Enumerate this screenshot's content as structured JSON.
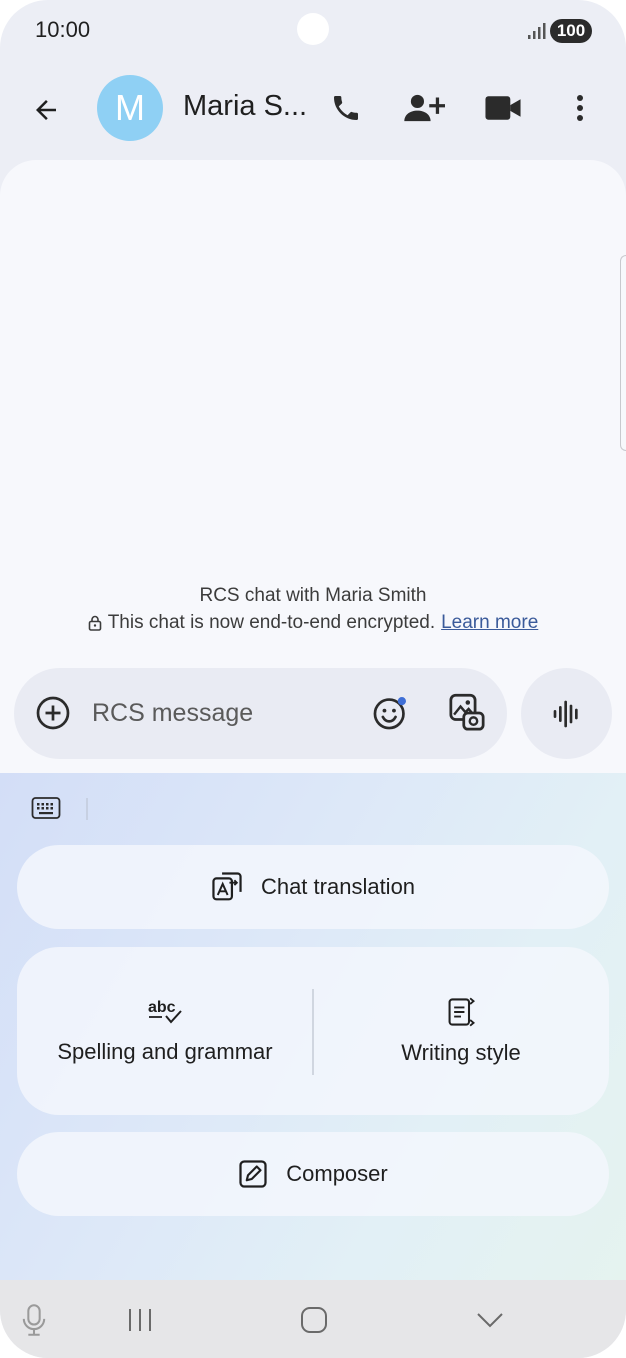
{
  "status_bar": {
    "time": "10:00",
    "battery": "100"
  },
  "header": {
    "avatar_letter": "M",
    "contact_name": "Maria S...",
    "avatar_color": "#8fd0f4"
  },
  "chat": {
    "info_title": "RCS chat with Maria Smith",
    "encryption_text": "This chat is now end-to-end encrypted.",
    "learn_more": "Learn more"
  },
  "compose": {
    "placeholder": "RCS message"
  },
  "ai_panel": {
    "chat_translation": "Chat translation",
    "spelling_grammar": "Spelling and grammar",
    "writing_style": "Writing style",
    "composer": "Composer"
  },
  "icons": {
    "back": "arrow-back-icon",
    "call": "phone-icon",
    "add_person": "person-add-icon",
    "video": "video-camera-icon",
    "more": "more-vert-icon",
    "add": "add-circle-icon",
    "emoji": "emoji-icon",
    "gallery": "gallery-icon",
    "voice": "voice-waveform-icon",
    "keyboard": "keyboard-icon",
    "translate": "translate-icon",
    "spellcheck": "spellcheck-icon",
    "style": "writing-style-icon",
    "edit": "edit-icon",
    "mic": "mic-icon",
    "recents": "recents-icon",
    "home": "home-icon",
    "hide": "chevron-down-icon",
    "lock": "lock-icon"
  }
}
